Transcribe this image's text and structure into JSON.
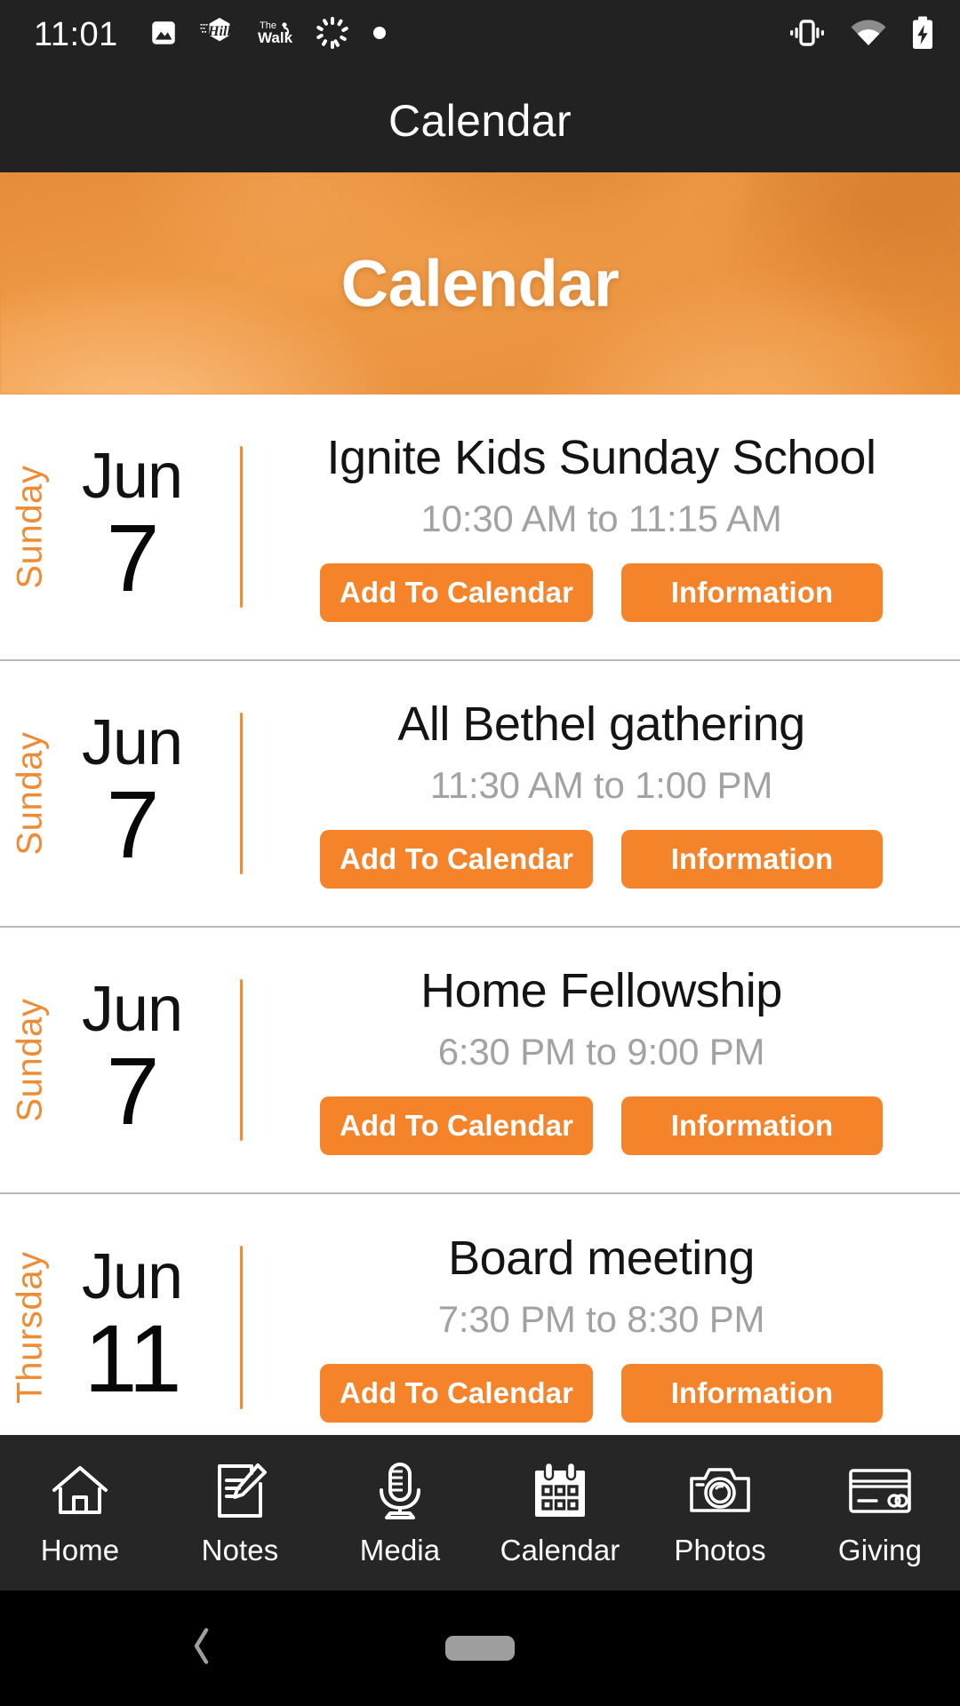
{
  "status_bar": {
    "time": "11:01",
    "left_icons": [
      "image-icon",
      "hill-app-icon",
      "the-walk-app-icon",
      "dotted-circle-icon",
      "dot-icon"
    ],
    "right_icons": [
      "vibrate-icon",
      "wifi-icon",
      "battery-charging-icon"
    ],
    "app_badge_hill_line1": "CHURCH",
    "app_badge_hill_line2": "ON THE",
    "app_badge_hill_line3": "HILL",
    "app_badge_hill_mark": "Hill",
    "app_badge_walk_line1": "The",
    "app_badge_walk_line2": "Walk"
  },
  "app_bar": {
    "title": "Calendar"
  },
  "hero": {
    "title": "Calendar"
  },
  "events": [
    {
      "day_name": "Sunday",
      "month": "Jun",
      "day_number": "7",
      "title": "Ignite Kids Sunday School",
      "time": "10:30 AM to 11:15 AM",
      "add_label": "Add To Calendar",
      "info_label": "Information"
    },
    {
      "day_name": "Sunday",
      "month": "Jun",
      "day_number": "7",
      "title": "All Bethel gathering",
      "time": "11:30 AM to 1:00 PM",
      "add_label": "Add To Calendar",
      "info_label": "Information"
    },
    {
      "day_name": "Sunday",
      "month": "Jun",
      "day_number": "7",
      "title": "Home Fellowship",
      "time": "6:30 PM to 9:00 PM",
      "add_label": "Add To Calendar",
      "info_label": "Information"
    },
    {
      "day_name": "Thursday",
      "month": "Jun",
      "day_number": "11",
      "title": "Board meeting",
      "time": "7:30 PM to 8:30 PM",
      "add_label": "Add To Calendar",
      "info_label": "Information"
    }
  ],
  "tab_bar": {
    "active": "Calendar",
    "tabs": [
      {
        "label": "Home",
        "icon": "home-icon"
      },
      {
        "label": "Notes",
        "icon": "note-pencil-icon"
      },
      {
        "label": "Media",
        "icon": "microphone-icon"
      },
      {
        "label": "Calendar",
        "icon": "calendar-icon"
      },
      {
        "label": "Photos",
        "icon": "camera-icon"
      },
      {
        "label": "Giving",
        "icon": "credit-card-icon"
      }
    ]
  },
  "android_nav": {
    "back_icon": "back-chevron-icon",
    "home_handle": "home-pill-handle"
  },
  "colors": {
    "accent_orange": "#f5832a",
    "day_name_orange": "#ef8b33",
    "status_bar_bg": "#222222",
    "tab_bar_bg": "#262626",
    "nav_bar_bg": "#000000",
    "page_bg": "#ffffff",
    "time_text_gray": "#a2a2a2",
    "separator_gray": "#b9b9b9"
  }
}
